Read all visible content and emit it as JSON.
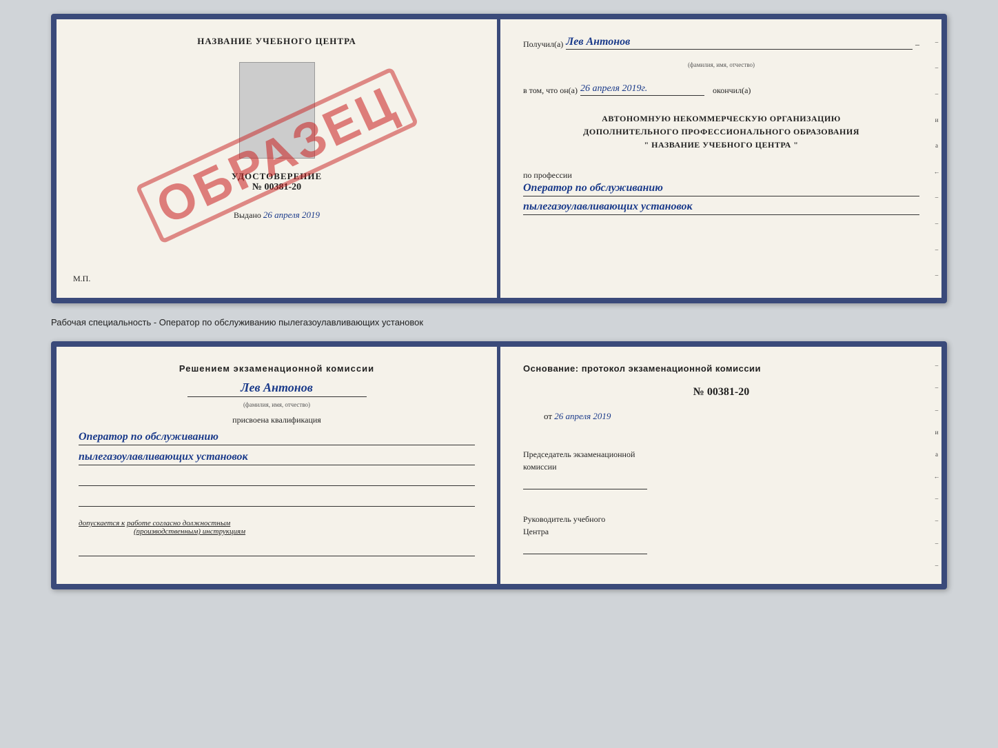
{
  "background_color": "#d0d4d8",
  "subtitle": "Рабочая специальность - Оператор по обслуживанию пылегазоулавливающих установок",
  "top_cert": {
    "left": {
      "title": "НАЗВАНИЕ УЧЕБНОГО ЦЕНТРА",
      "stamp": "ОБРАЗЕЦ",
      "doc_label": "УДОСТОВЕРЕНИЕ",
      "doc_number": "№ 00381-20",
      "issued_label": "Выдано",
      "issued_date": "26 апреля 2019",
      "mp_label": "М.П."
    },
    "right": {
      "received_label": "Получил(а)",
      "received_name": "Лев Антонов",
      "received_subtext": "(фамилия, имя, отчество)",
      "received_dash": "–",
      "in_that_label": "в том, что он(а)",
      "in_that_date": "26 апреля 2019г.",
      "finished_label": "окончил(а)",
      "org_line1": "АВТОНОМНУЮ НЕКОММЕРЧЕСКУЮ ОРГАНИЗАЦИЮ",
      "org_line2": "ДОПОЛНИТЕЛЬНОГО ПРОФЕССИОНАЛЬНОГО ОБРАЗОВАНИЯ",
      "org_line3": "\" НАЗВАНИЕ УЧЕБНОГО ЦЕНТРА \"",
      "profession_label": "по профессии",
      "profession_line1": "Оператор по обслуживанию",
      "profession_line2": "пылегазоулавливающих установок"
    }
  },
  "bottom_cert": {
    "left": {
      "heading": "Решением экзаменационной комиссии",
      "name": "Лев Антонов",
      "name_subtext": "(фамилия, имя, отчество)",
      "assigned_label": "присвоена квалификация",
      "profession_line1": "Оператор по обслуживанию",
      "profession_line2": "пылегазоулавливающих установок",
      "allowed_text": "допускается к",
      "allowed_value": "работе согласно должностным",
      "allowed_value2": "(производственным) инструкциям"
    },
    "right": {
      "basis_label": "Основание: протокол экзаменационной комиссии",
      "protocol_number": "№ 00381-20",
      "date_prefix": "от",
      "date_value": "26 апреля 2019",
      "chairman_label": "Председатель экзаменационной",
      "chairman_label2": "комиссии",
      "director_label": "Руководитель учебного",
      "director_label2": "Центра"
    }
  },
  "side_markers": [
    "–",
    "–",
    "–",
    "и",
    "а",
    "←",
    "–",
    "–",
    "–",
    "–"
  ],
  "side_markers2": [
    "–",
    "–",
    "–",
    "и",
    "а",
    "←",
    "–",
    "–",
    "–",
    "–"
  ]
}
